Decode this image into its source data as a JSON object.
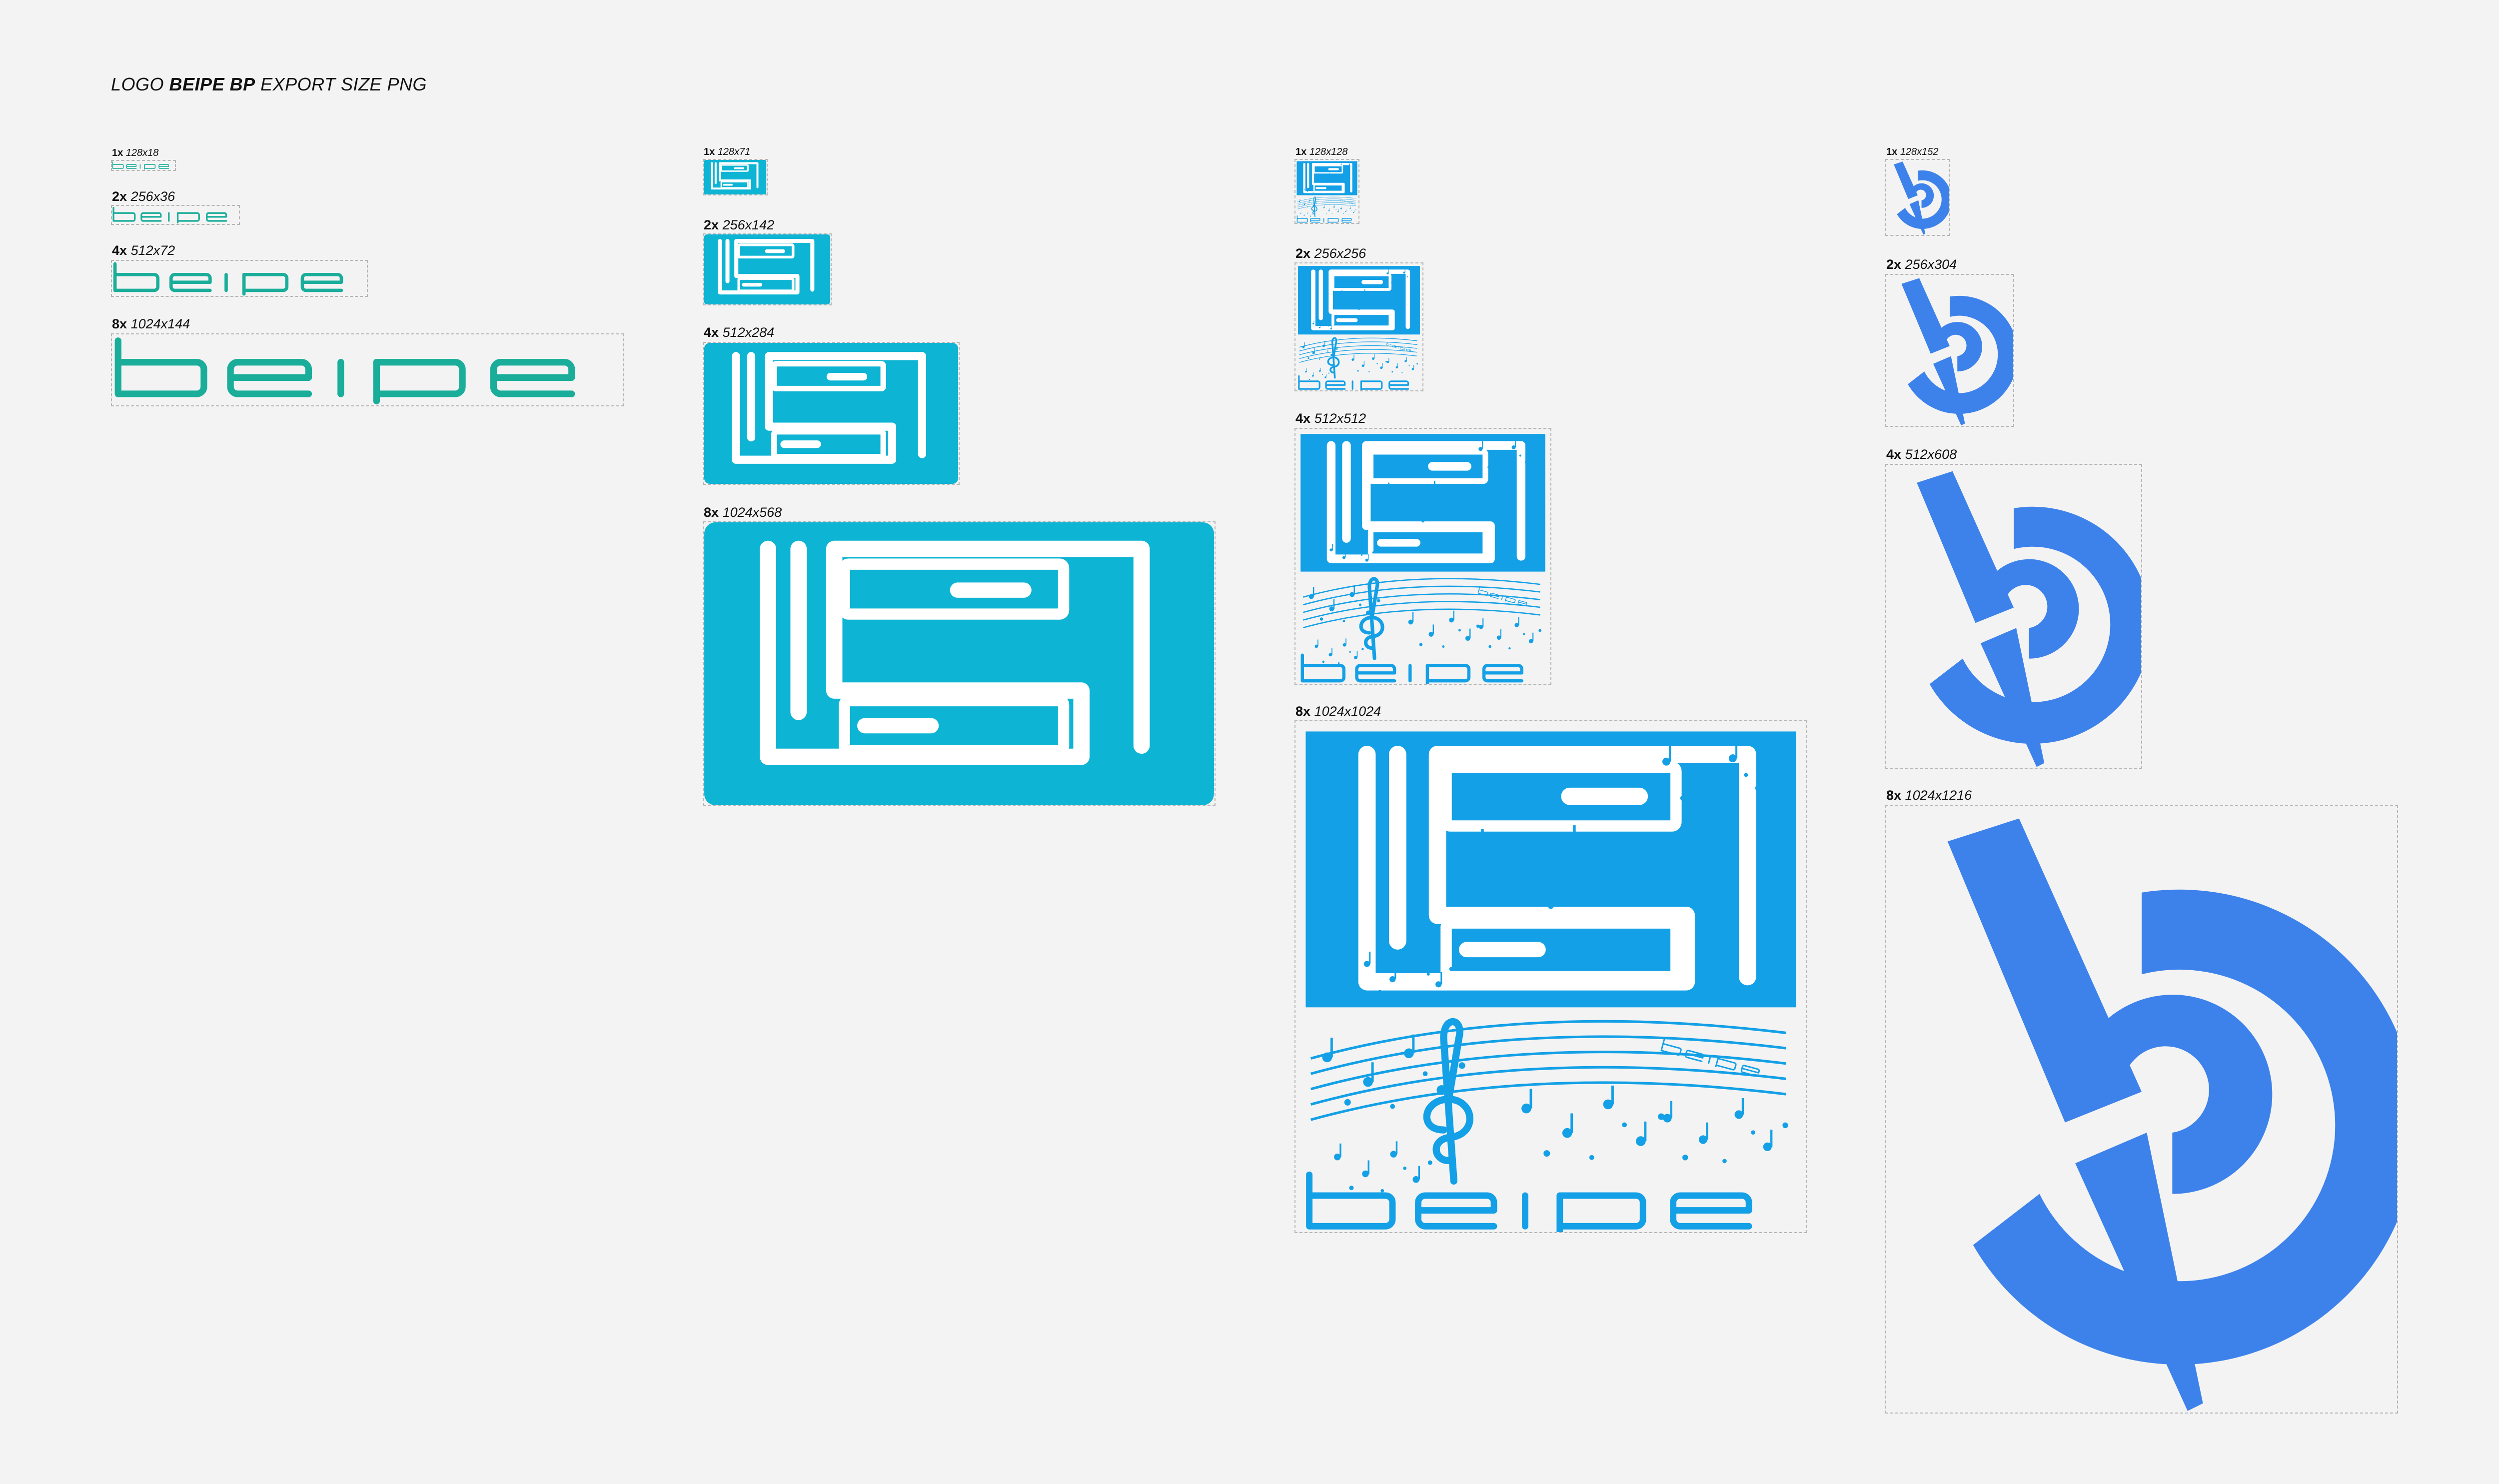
{
  "title": {
    "prefix": "LOGO",
    "brand": "BEIPE BP",
    "suffix": "EXPORT SIZE PNG"
  },
  "colors": {
    "wordmark": "#1aae9a",
    "monogram": "#0db4d3",
    "music": "#13a0e6",
    "bp": "#3d82eb",
    "background": "#f3f3f3"
  },
  "icons": [
    "beipe-wordmark",
    "bs-monogram",
    "bs-music-logo",
    "bp-circle-logo"
  ],
  "groups": [
    {
      "name": "beipe-wordmark",
      "sizes": [
        {
          "mult": "1x",
          "dims": "128x18"
        },
        {
          "mult": "2x",
          "dims": "256x36"
        },
        {
          "mult": "4x",
          "dims": "512x72"
        },
        {
          "mult": "8x",
          "dims": "1024x144"
        }
      ]
    },
    {
      "name": "bs-monogram",
      "sizes": [
        {
          "mult": "1x",
          "dims": "128x71"
        },
        {
          "mult": "2x",
          "dims": "256x142"
        },
        {
          "mult": "4x",
          "dims": "512x284"
        },
        {
          "mult": "8x",
          "dims": "1024x568"
        }
      ]
    },
    {
      "name": "bs-music-logo",
      "sizes": [
        {
          "mult": "1x",
          "dims": "128x128"
        },
        {
          "mult": "2x",
          "dims": "256x256"
        },
        {
          "mult": "4x",
          "dims": "512x512"
        },
        {
          "mult": "8x",
          "dims": "1024x1024"
        }
      ]
    },
    {
      "name": "bp-circle-logo",
      "sizes": [
        {
          "mult": "1x",
          "dims": "128x152"
        },
        {
          "mult": "2x",
          "dims": "256x304"
        },
        {
          "mult": "4x",
          "dims": "512x608"
        },
        {
          "mult": "8x",
          "dims": "1024x1216"
        }
      ]
    }
  ],
  "music_logo_word": "beipe"
}
